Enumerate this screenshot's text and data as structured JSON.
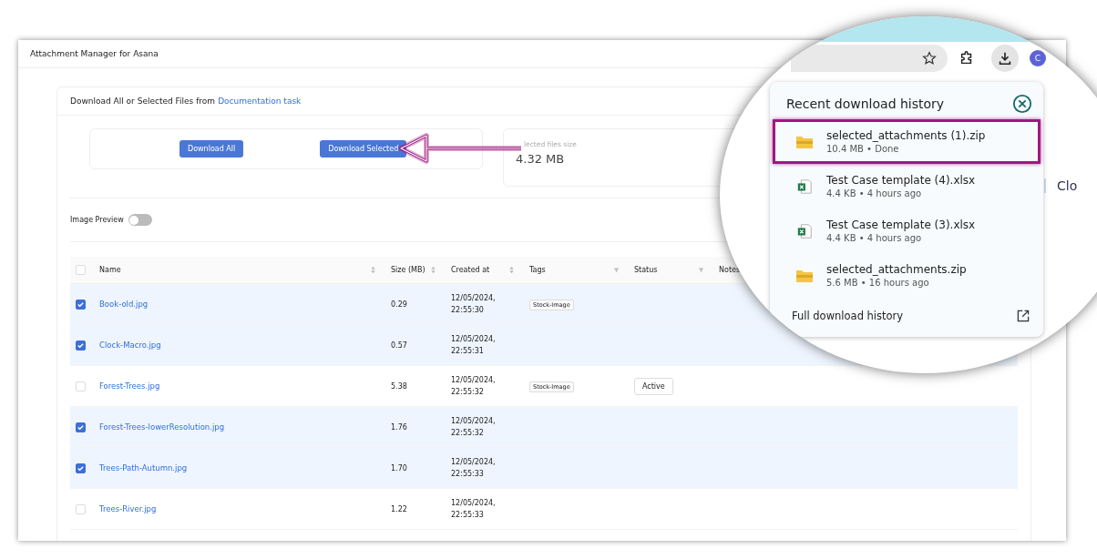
{
  "window": {
    "title": "Attachment Manager for Asana"
  },
  "card": {
    "heading": "Download All or Selected Files from",
    "task_link": "Documentation task"
  },
  "buttons": [
    "Download All",
    "Download Selected"
  ],
  "stats": {
    "label": "lected files size",
    "value": "4.32 MB"
  },
  "image_preview": {
    "label": "Image Preview",
    "on": false
  },
  "table": {
    "all_checked": false,
    "columns": [
      {
        "label": "Name",
        "kind": "sort"
      },
      {
        "label": "Size (MB)",
        "kind": "sort"
      },
      {
        "label": "Created at",
        "kind": "sort"
      },
      {
        "label": "Tags",
        "kind": "filter"
      },
      {
        "label": "Status",
        "kind": "filter"
      },
      {
        "label": "Notes",
        "kind": "plain"
      }
    ],
    "rows": [
      {
        "checked": true,
        "name": "Book-old.jpg",
        "size": "0.29",
        "date": "12/05/2024,",
        "time": "22:55:30",
        "tag": "Stock-Image"
      },
      {
        "checked": true,
        "name": "Clock-Macro.jpg",
        "size": "0.57",
        "date": "12/05/2024,",
        "time": "22:55:31"
      },
      {
        "checked": false,
        "name": "Forest-Trees.jpg",
        "size": "5.38",
        "date": "12/05/2024,",
        "time": "22:55:32",
        "tag": "Stock-Image",
        "status": "Active"
      },
      {
        "checked": true,
        "name": "Forest-Trees-lowerResolution.jpg",
        "size": "1.76",
        "date": "12/05/2024,",
        "time": "22:55:32"
      },
      {
        "checked": true,
        "name": "Trees-Path-Autumn.jpg",
        "size": "1.70",
        "date": "12/05/2024,",
        "time": "22:55:33"
      },
      {
        "checked": false,
        "name": "Trees-River.jpg",
        "size": "1.22",
        "date": "12/05/2024,",
        "time": "22:55:33"
      }
    ]
  },
  "browser": {
    "avatar": "C",
    "side_button": "Clo",
    "downloads": {
      "title": "Recent download history",
      "footer": "Full download history",
      "items": [
        {
          "kind": "zip",
          "name": "selected_attachments (1).zip",
          "detail": "10.4 MB • Done",
          "highlighted": true
        },
        {
          "kind": "excel",
          "name": "Test Case template (4).xlsx",
          "detail": "4.4 KB • 4 hours ago",
          "highlighted": false
        },
        {
          "kind": "excel",
          "name": "Test Case template (3).xlsx",
          "detail": "4.4 KB • 4 hours ago",
          "highlighted": false
        },
        {
          "kind": "zip",
          "name": "selected_attachments.zip",
          "detail": "5.6 MB • 16 hours ago",
          "highlighted": false
        }
      ]
    }
  }
}
